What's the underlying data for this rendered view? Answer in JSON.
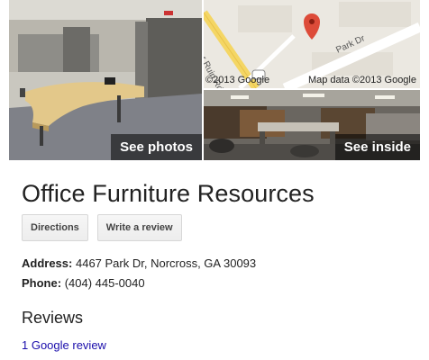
{
  "photos": {
    "see_photos_label": "See photos",
    "see_inside_label": "See inside"
  },
  "map": {
    "copyright": "©2013 Google",
    "map_data": "Map data ©2013 Google",
    "street_park": "Park Dr",
    "street_beaver": "Beaver Ruin Rd",
    "pin_color": "#dd4b39"
  },
  "business": {
    "name": "Office Furniture Resources",
    "directions_label": "Directions",
    "write_review_label": "Write a review",
    "address_label": "Address:",
    "address_value": "4467 Park Dr, Norcross, GA 30093",
    "phone_label": "Phone:",
    "phone_value": "(404) 445-0040"
  },
  "reviews": {
    "heading": "Reviews",
    "link_text": "1 Google review",
    "link_color": "#1a0dab"
  }
}
